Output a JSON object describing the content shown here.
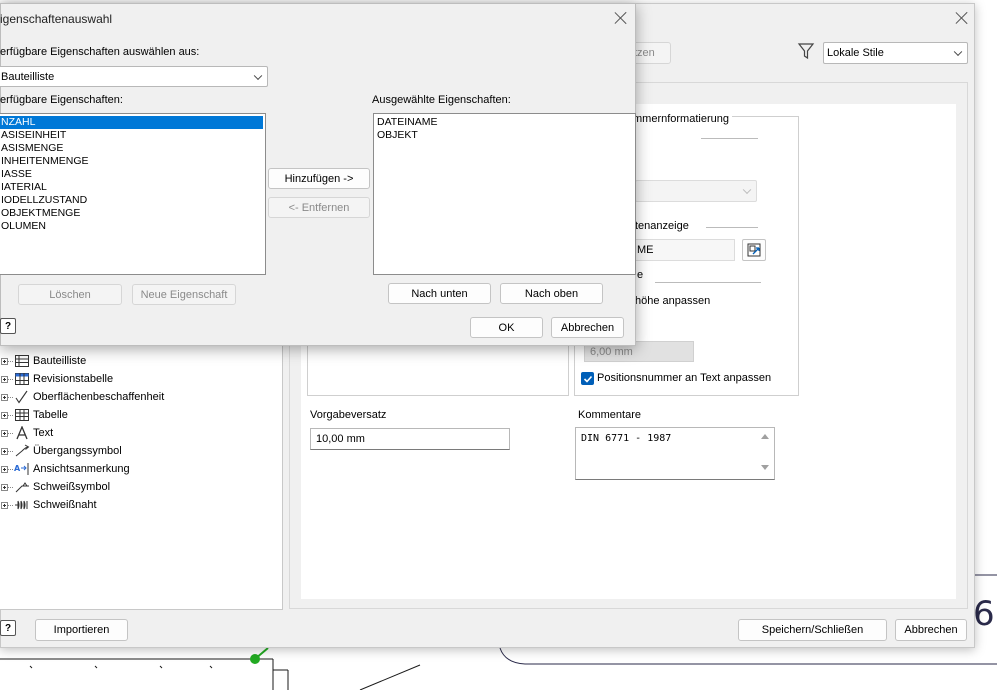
{
  "back_dialog": {
    "toolbar": {
      "partial_button_label": "tzen",
      "style_filter_value": "Lokale Stile"
    },
    "tree": {
      "items": [
        {
          "label": "Bauteilliste",
          "icon": "parts-list-icon"
        },
        {
          "label": "Revisionstabelle",
          "icon": "revision-table-icon"
        },
        {
          "label": "Oberflächenbeschaffenheit",
          "icon": "surface-texture-icon"
        },
        {
          "label": "Tabelle",
          "icon": "table-icon"
        },
        {
          "label": "Text",
          "icon": "text-icon"
        },
        {
          "label": "Übergangssymbol",
          "icon": "transition-symbol-icon"
        },
        {
          "label": "Ansichtsanmerkung",
          "icon": "view-annotation-icon"
        },
        {
          "label": "Schweißsymbol",
          "icon": "weld-symbol-icon"
        },
        {
          "label": "Schweißnaht",
          "icon": "weld-bead-icon"
        }
      ]
    },
    "balloon_format": {
      "group_title_partial": "mmernformatierung",
      "display_title_partial": "tenanzeige",
      "display_value_partial": "ME",
      "group3_partial": "e",
      "fit_height_partial": "höhe anpassen",
      "disabled_value": "6,00 mm",
      "fit_text_label": "Positionsnummer an Text anpassen",
      "fit_text_checked": true
    },
    "default_offset": {
      "label": "Vorgabeversatz",
      "value": "10,00 mm"
    },
    "comments": {
      "label": "Kommentare",
      "value": "DIN 6771 - 1987"
    },
    "footer": {
      "import_label": "Importieren",
      "save_close_label": "Speichern/Schließen",
      "cancel_label": "Abbrechen"
    },
    "background_glyph": "6"
  },
  "front_dialog": {
    "title": "igenschaftenauswahl",
    "source_label": "erfügbare Eigenschaften auswählen aus:",
    "source_value": "Bauteilliste",
    "available_label": "erfügbare Eigenschaften:",
    "available_items": [
      "NZAHL",
      "ASISEINHEIT",
      "ASISMENGE",
      "INHEITENMENGE",
      "IASSE",
      "IATERIAL",
      "IODELLZUSTAND",
      "OBJEKTMENGE",
      "OLUMEN"
    ],
    "available_selected_index": 0,
    "selected_label": "Ausgewählte Eigenschaften:",
    "selected_items": [
      "DATEINAME",
      "OBJEKT"
    ],
    "add_label": "Hinzufügen ->",
    "remove_label": "<- Entfernen",
    "delete_label": "Löschen",
    "new_property_label": "Neue Eigenschaft",
    "move_down_label": "Nach unten",
    "move_up_label": "Nach oben",
    "ok_label": "OK",
    "cancel_label": "Abbrechen"
  }
}
